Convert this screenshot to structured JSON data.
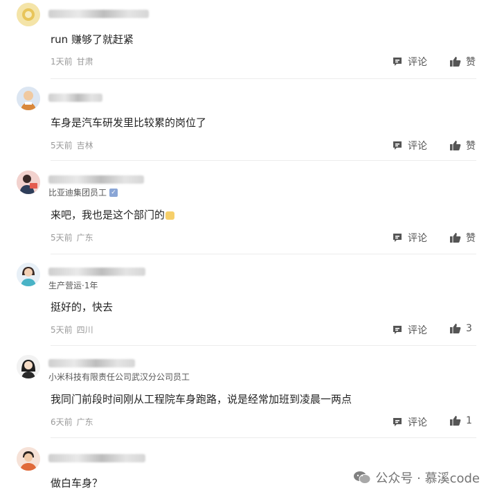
{
  "icons": {
    "comment": "comment-bubble-icon",
    "like": "thumbs-up-icon",
    "watermark": "wechat-icon"
  },
  "colors": {
    "meta": "#9a9a9a",
    "divider": "#ececec",
    "verified": "#8aa6d6"
  },
  "comments": [
    {
      "text": "run 赚够了就赶紧",
      "time": "1天前",
      "location": "甘肃",
      "reply_label": "评论",
      "like_label": "赞"
    },
    {
      "text": "车身是汽车研发里比较累的岗位了",
      "time": "5天前",
      "location": "吉林",
      "reply_label": "评论",
      "like_label": "赞"
    },
    {
      "subtitle": "比亚迪集团员工",
      "text": "来吧，我也是这个部门的",
      "time": "5天前",
      "location": "广东",
      "reply_label": "评论",
      "like_label": "赞"
    },
    {
      "subtitle": "生产营运·1年",
      "text": "挺好的，快去",
      "time": "5天前",
      "location": "四川",
      "reply_label": "评论",
      "like_label": "3"
    },
    {
      "subtitle": "小米科技有限责任公司武汉分公司员工",
      "text": "我同门前段时间刚从工程院车身跑路，说是经常加班到凌晨一两点",
      "time": "6天前",
      "location": "广东",
      "reply_label": "评论",
      "like_label": "1"
    },
    {
      "text": "做白车身？"
    }
  ],
  "watermark": {
    "text": "公众号 · 慕溪code"
  }
}
